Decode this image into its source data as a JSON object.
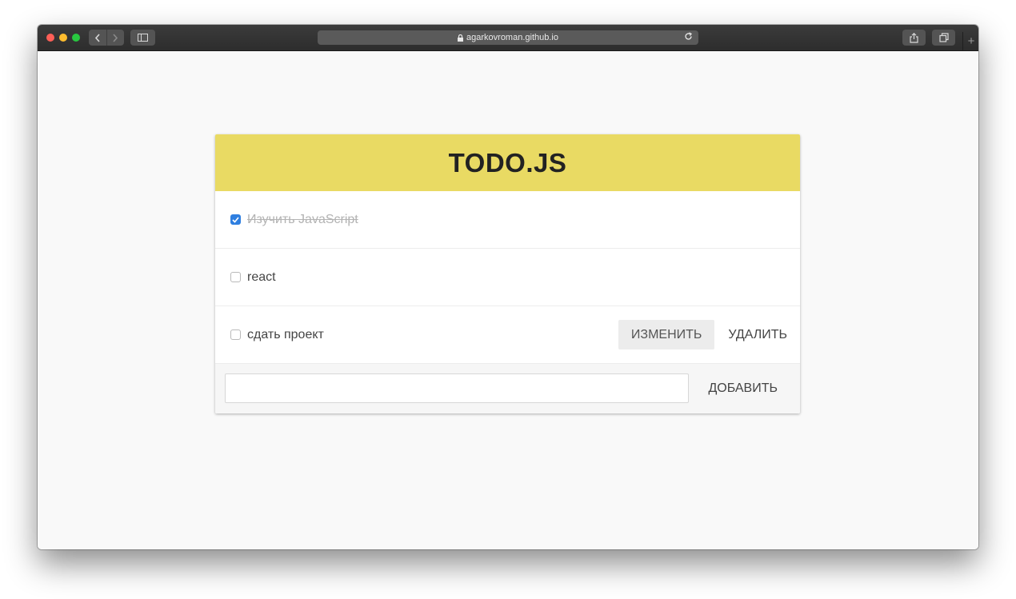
{
  "browser": {
    "url": "agarkovroman.github.io",
    "new_tab": "+"
  },
  "app": {
    "title": "TODO.JS"
  },
  "todos": [
    {
      "text": "Изучить JavaScript",
      "completed": true
    },
    {
      "text": "react",
      "completed": false
    },
    {
      "text": "сдать проект",
      "completed": false
    }
  ],
  "actions": {
    "edit_label": "ИЗМЕНИТЬ",
    "delete_label": "УДАЛИТЬ",
    "add_label": "ДОБАВИТЬ"
  },
  "add_form": {
    "input_value": "",
    "input_placeholder": ""
  },
  "colors": {
    "header": "#e9da63",
    "checkbox_checked": "#2f7fe0"
  }
}
